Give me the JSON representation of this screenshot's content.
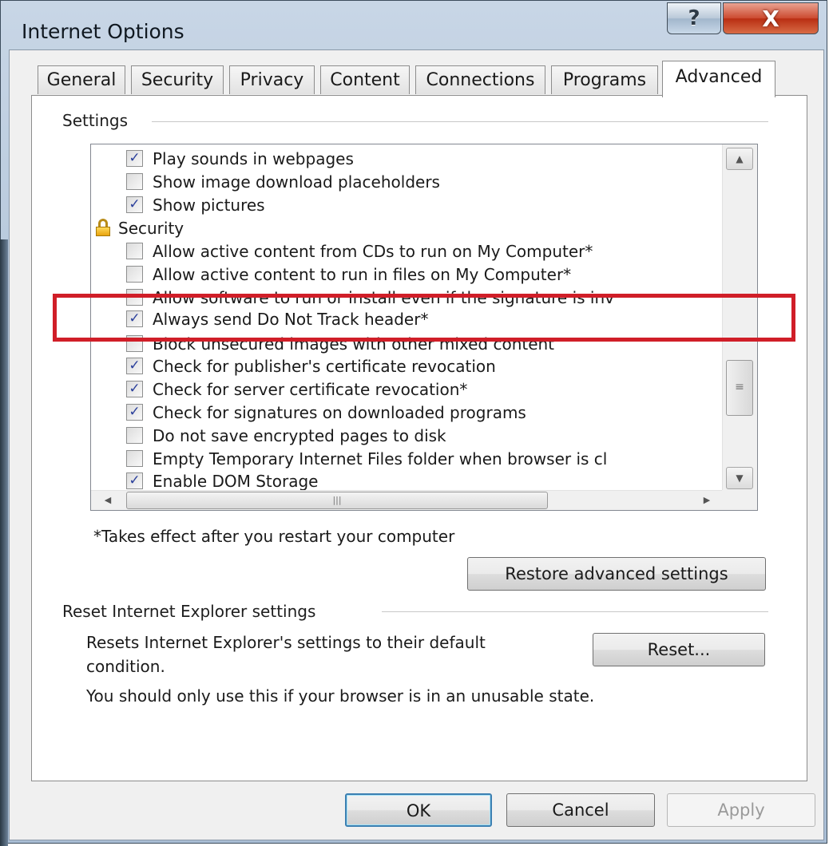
{
  "window": {
    "title": "Internet Options",
    "help_glyph": "?",
    "close_glyph": "X"
  },
  "tabs": [
    {
      "label": "General"
    },
    {
      "label": "Security"
    },
    {
      "label": "Privacy"
    },
    {
      "label": "Content"
    },
    {
      "label": "Connections"
    },
    {
      "label": "Programs"
    },
    {
      "label": "Advanced",
      "active": true
    }
  ],
  "settings": {
    "group_label": "Settings",
    "items": [
      {
        "type": "option",
        "label": "Play sounds in webpages",
        "checked": true
      },
      {
        "type": "option",
        "label": "Show image download placeholders",
        "checked": false
      },
      {
        "type": "option",
        "label": "Show pictures",
        "checked": true
      },
      {
        "type": "category",
        "label": "Security",
        "icon": "lock-icon"
      },
      {
        "type": "option",
        "label": "Allow active content from CDs to run on My Computer*",
        "checked": false
      },
      {
        "type": "option",
        "label": "Allow active content to run in files on My Computer*",
        "checked": false
      },
      {
        "type": "option",
        "label": "Allow software to run or install even if the signature is inv",
        "checked": false
      },
      {
        "type": "option",
        "label": "Always send Do Not Track header*",
        "checked": true
      },
      {
        "type": "option",
        "label": "Block unsecured images with other mixed content",
        "checked": false
      },
      {
        "type": "option",
        "label": "Check for publisher's certificate revocation",
        "checked": true
      },
      {
        "type": "option",
        "label": "Check for server certificate revocation*",
        "checked": true
      },
      {
        "type": "option",
        "label": "Check for signatures on downloaded programs",
        "checked": true
      },
      {
        "type": "option",
        "label": "Do not save encrypted pages to disk",
        "checked": false
      },
      {
        "type": "option",
        "label": "Empty Temporary Internet Files folder when browser is cl",
        "checked": false
      },
      {
        "type": "option",
        "label": "Enable DOM Storage",
        "checked": true
      }
    ],
    "footnote": "*Takes effect after you restart your computer",
    "restore_button": "Restore advanced settings"
  },
  "reset": {
    "group_label": "Reset Internet Explorer settings",
    "description_line1": "Resets Internet Explorer's settings to their default",
    "description_line2": "condition.",
    "warning": "You should only use this if your browser is in an unusable state.",
    "button": "Reset..."
  },
  "footer": {
    "ok": "OK",
    "cancel": "Cancel",
    "apply": "Apply"
  },
  "colors": {
    "highlight": "#d01e28",
    "check": "#2a3f9b"
  }
}
